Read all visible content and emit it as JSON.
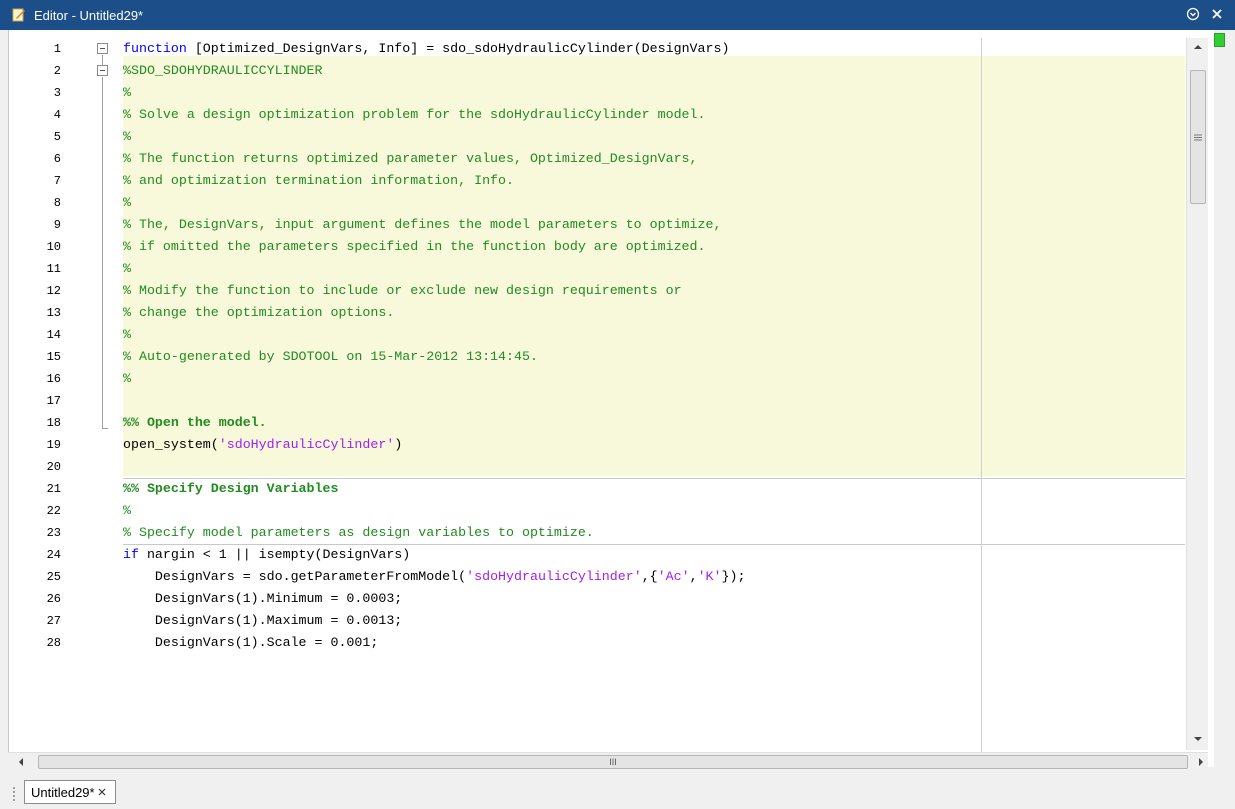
{
  "window": {
    "title": "Editor - Untitled29*",
    "menu_icon": "chevron-circle-icon",
    "close_icon": "close-icon"
  },
  "editor": {
    "line_numbers": [
      "1",
      "2",
      "3",
      "4",
      "5",
      "6",
      "7",
      "8",
      "9",
      "10",
      "11",
      "12",
      "13",
      "14",
      "15",
      "16",
      "17",
      "18",
      "19",
      "20",
      "21",
      "22",
      "23",
      "24",
      "25",
      "26",
      "27",
      "28"
    ],
    "lines": [
      [
        {
          "t": "function",
          "c": "kw"
        },
        {
          "t": " [Optimized_DesignVars, Info] = sdo_sdoHydraulicCylinder(DesignVars)",
          "c": ""
        }
      ],
      [
        {
          "t": "%SDO_SDOHYDRAULICCYLINDER",
          "c": "cm"
        }
      ],
      [
        {
          "t": "%",
          "c": "cm"
        }
      ],
      [
        {
          "t": "% Solve a design optimization problem for the sdoHydraulicCylinder model.",
          "c": "cm"
        }
      ],
      [
        {
          "t": "%",
          "c": "cm"
        }
      ],
      [
        {
          "t": "% The function returns optimized parameter values, Optimized_DesignVars,",
          "c": "cm"
        }
      ],
      [
        {
          "t": "% and optimization termination information, Info.",
          "c": "cm"
        }
      ],
      [
        {
          "t": "%",
          "c": "cm"
        }
      ],
      [
        {
          "t": "% The, DesignVars, input argument defines the model parameters to optimize,",
          "c": "cm"
        }
      ],
      [
        {
          "t": "% if omitted the parameters specified in the function body are optimized.",
          "c": "cm"
        }
      ],
      [
        {
          "t": "%",
          "c": "cm"
        }
      ],
      [
        {
          "t": "% Modify the function to include or exclude new design requirements or",
          "c": "cm"
        }
      ],
      [
        {
          "t": "% change the optimization options.",
          "c": "cm"
        }
      ],
      [
        {
          "t": "%",
          "c": "cm"
        }
      ],
      [
        {
          "t": "% Auto-generated by SDOTOOL on 15-Mar-2012 13:14:45.",
          "c": "cm"
        }
      ],
      [
        {
          "t": "%",
          "c": "cm"
        }
      ],
      [
        {
          "t": "",
          "c": ""
        }
      ],
      [
        {
          "t": "%% Open the model.",
          "c": "cm bold"
        }
      ],
      [
        {
          "t": "open_system(",
          "c": ""
        },
        {
          "t": "'sdoHydraulicCylinder'",
          "c": "str"
        },
        {
          "t": ")",
          "c": ""
        }
      ],
      [
        {
          "t": "",
          "c": ""
        }
      ],
      [
        {
          "t": "%% Specify Design Variables",
          "c": "cm bold"
        }
      ],
      [
        {
          "t": "%",
          "c": "cm"
        }
      ],
      [
        {
          "t": "% Specify model parameters as design variables to optimize.",
          "c": "cm"
        }
      ],
      [
        {
          "t": "if",
          "c": "kw"
        },
        {
          "t": " nargin < 1 || isempty(DesignVars)",
          "c": ""
        }
      ],
      [
        {
          "t": "    DesignVars = sdo.getParameterFromModel(",
          "c": ""
        },
        {
          "t": "'sdoHydraulicCylinder'",
          "c": "str"
        },
        {
          "t": ",{",
          "c": ""
        },
        {
          "t": "'Ac'",
          "c": "str"
        },
        {
          "t": ",",
          "c": ""
        },
        {
          "t": "'K'",
          "c": "str"
        },
        {
          "t": "});",
          "c": ""
        }
      ],
      [
        {
          "t": "    DesignVars(1).Minimum = 0.0003;",
          "c": ""
        }
      ],
      [
        {
          "t": "    DesignVars(1).Maximum = 0.0013;",
          "c": ""
        }
      ],
      [
        {
          "t": "    DesignVars(1).Scale = 0.001;",
          "c": ""
        }
      ]
    ]
  },
  "scrollbar": {
    "h_grip": "III"
  },
  "tabs": [
    {
      "label": "Untitled29*",
      "close_icon": "close-icon"
    }
  ]
}
